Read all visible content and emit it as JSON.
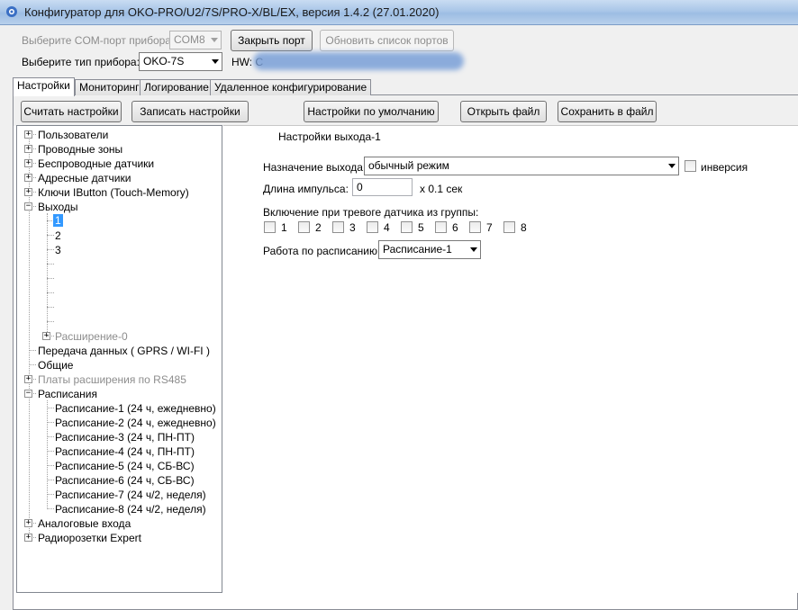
{
  "window": {
    "title": "Конфигуратор для OKO-PRO/U2/7S/PRO-X/BL/EX, версия 1.4.2 (27.01.2020)",
    "icon": "gear-app-icon"
  },
  "top": {
    "com_port_label": "Выберите COM-порт прибора:",
    "com_port_value": "COM8",
    "close_port_button": "Закрыть порт",
    "refresh_ports_button": "Обновить список портов",
    "device_type_label": "Выберите тип прибора:",
    "device_type_value": "OKO-7S",
    "hw_label": "HW: C"
  },
  "tabs": [
    {
      "label": "Настройки",
      "active": true
    },
    {
      "label": "Мониторинг"
    },
    {
      "label": "Логирование"
    },
    {
      "label": "Удаленное конфигурирование"
    }
  ],
  "toolbar": {
    "read_settings": "Считать настройки",
    "write_settings": "Записать настройки",
    "default_settings": "Настройки по умолчанию",
    "open_file": "Открыть файл",
    "save_file": "Сохранить в файл"
  },
  "tree": {
    "users": "Пользователи",
    "wired_zones": "Проводные зоны",
    "wireless_sensors": "Беспроводные датчики",
    "address_sensors": "Адресные датчики",
    "ibutton_keys": "Ключи IButton (Touch-Memory)",
    "outputs": "Выходы",
    "output_items": [
      "1",
      "2",
      "3"
    ],
    "extension": "Расширение-0",
    "data_transfer": "Передача данных ( GPRS / WI-FI )",
    "general": "Общие",
    "rs485_boards": "Платы расширения по RS485",
    "schedules": "Расписания",
    "schedule_items": [
      "Расписание-1 (24 ч, ежедневно)",
      "Расписание-2 (24 ч, ежедневно)",
      "Расписание-3 (24 ч, ПН-ПТ)",
      "Расписание-4 (24 ч, ПН-ПТ)",
      "Расписание-5 (24 ч, СБ-ВС)",
      "Расписание-6 (24 ч, СБ-ВС)",
      "Расписание-7 (24 ч/2, неделя)",
      "Расписание-8 (24 ч/2, неделя)"
    ],
    "analog_inputs": "Аналоговые входа",
    "radio_sockets": "Радиорозетки Expert"
  },
  "output_settings": {
    "heading": "Настройки выхода-1",
    "purpose_label": "Назначение выхода:",
    "purpose_value": "обычный режим",
    "inversion_label": "инверсия",
    "pulse_label": "Длина импульса:",
    "pulse_value": "0",
    "pulse_unit": "x 0.1 сек",
    "groups_label": "Включение при тревоге датчика из группы:",
    "groups": [
      "1",
      "2",
      "3",
      "4",
      "5",
      "6",
      "7",
      "8"
    ],
    "schedule_label": "Работа по расписанию:",
    "schedule_value": "Расписание-1"
  },
  "colors": {
    "selection": "#3399ff",
    "titlebar": "#a9c6e8"
  }
}
